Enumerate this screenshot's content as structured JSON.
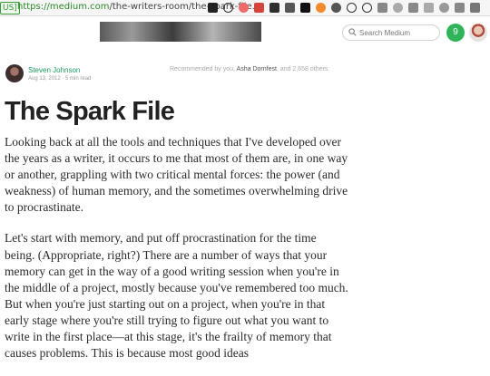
{
  "browser": {
    "badge": "US]",
    "url_host": "https://medium.com",
    "url_path": "/the-writers-room/the-spark-file...",
    "extension_icons": [
      {
        "name": "buffer-icon",
        "color": "#222222",
        "shape": "square"
      },
      {
        "name": "info-icon",
        "color": "#333333",
        "shape": "ring"
      },
      {
        "name": "asana-icon",
        "color": "#f06a6a",
        "shape": "round"
      },
      {
        "name": "calendar-icon",
        "color": "#d6453b",
        "shape": "square"
      },
      {
        "name": "evernote-icon",
        "color": "#2e2e2e",
        "shape": "square"
      },
      {
        "name": "downloads-icon",
        "color": "#555555",
        "shape": "square"
      },
      {
        "name": "instapaper-icon",
        "color": "#111111",
        "shape": "square"
      },
      {
        "name": "honey-icon",
        "color": "#f28a2e",
        "shape": "round"
      },
      {
        "name": "pocket-icon",
        "color": "#555555",
        "shape": "round"
      },
      {
        "name": "compass-icon",
        "color": "#333333",
        "shape": "ring"
      },
      {
        "name": "block-icon",
        "color": "#333333",
        "shape": "ring"
      },
      {
        "name": "screenshot-icon",
        "color": "#888888",
        "shape": "square"
      },
      {
        "name": "ghostery-icon",
        "color": "#aaaaaa",
        "shape": "round"
      },
      {
        "name": "chat-icon",
        "color": "#888888",
        "shape": "square"
      },
      {
        "name": "share-icon",
        "color": "#aaaaaa",
        "shape": "square"
      },
      {
        "name": "grammarly-icon",
        "color": "#999999",
        "shape": "round"
      },
      {
        "name": "clipper-icon",
        "color": "#888888",
        "shape": "square"
      },
      {
        "name": "menu-icon",
        "color": "#777777",
        "shape": "square"
      }
    ]
  },
  "header": {
    "search_placeholder": "Search Medium",
    "notification_count": "9"
  },
  "post": {
    "author": "Steven Johnson",
    "meta": "Aug 13, 2012 · 5 min read",
    "recommended_prefix": "Recommended by you, ",
    "recommended_names": "Asha Dornfest",
    "recommended_suffix": ", and 2,658 others",
    "title": "The Spark File",
    "paragraphs": [
      "Looking back at all the tools and techniques that I've developed over the years as a writer, it occurs to me that most of them are, in one way or another, grappling with two critical mental forces: the power (and weakness) of human memory, and the sometimes overwhelming drive to procrastinate.",
      "Let's start with memory, and put off procrastination for the time being. (Appropriate, right?) There are a number of ways that your memory can get in the way of a good writing session when you're in the middle of a project, mostly because you've remembered too much. But when you're just starting out on a project, when you're in that early stage where you're still trying to figure out what you want to write in the first place—at this stage, it's the frailty of memory that causes problems. This is because most good ideas"
    ]
  }
}
